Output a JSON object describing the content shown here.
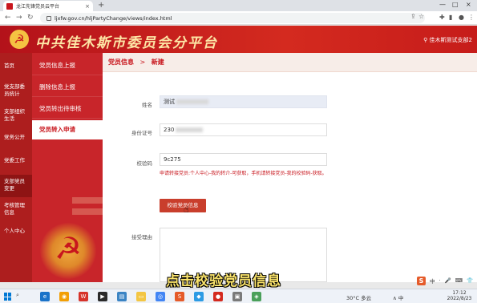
{
  "browser": {
    "tab_title": "龙江先锋党员云平台",
    "tab_close": "×",
    "new_tab": "+",
    "window_controls": [
      "—",
      "□",
      "×"
    ],
    "nav_icons": {
      "back": "←",
      "forward": "→",
      "reload": "↻"
    },
    "url": "ljxfw.gov.cn/hljPartyChange/views/index.html",
    "omni_icons": [
      "share-icon",
      "star-icon"
    ],
    "toolbar_icons": [
      "puzzle-icon",
      "sidebar-icon",
      "profile-icon",
      "more-icon"
    ]
  },
  "header": {
    "title": "中共佳木斯市委员会分平台",
    "emblem_glyph": "☭",
    "user": "佳木斯测试支部2",
    "user_icon": "user-icon"
  },
  "leftnav": [
    {
      "label": "首页",
      "active": false
    },
    {
      "label": "党支部委员统计",
      "active": false
    },
    {
      "label": "支部组织生活",
      "active": false
    },
    {
      "label": "党务公开",
      "active": false
    },
    {
      "label": "党委工作",
      "active": false
    },
    {
      "label": "支部党员变更",
      "active": true
    },
    {
      "label": "考核管理信息",
      "active": false
    },
    {
      "label": "个人中心",
      "active": false
    }
  ],
  "subnav": [
    {
      "label": "党员信息上报",
      "active": false
    },
    {
      "label": "删除信息上报",
      "active": false
    },
    {
      "label": "党员转出待审核",
      "active": false
    },
    {
      "label": "党员转入申请",
      "active": true
    }
  ],
  "breadcrumb": {
    "section": "党员信息",
    "separator": ">",
    "page": "新建"
  },
  "form": {
    "name_label": "姓名",
    "name_value": "测试",
    "id_label": "身份证号",
    "id_value": "230",
    "code_label": "校验码",
    "code_value": "9c275",
    "hint": "申请转接党员:个人中心-我的转介-可获取，手机请转接党员-我的校验码-获取。",
    "verify_button": "校验党员信息",
    "reason_label": "接受理由"
  },
  "subtitle": "点击校验党员信息",
  "ime": {
    "logo": "S",
    "items": [
      "中",
      "·",
      "🎤",
      "⌨",
      "👕",
      "⚙"
    ]
  },
  "taskbar": {
    "apps": [
      {
        "name": "edge",
        "color": "#1a73c9",
        "glyph": "e"
      },
      {
        "name": "chrome-orange",
        "color": "#f29f05",
        "glyph": "◉"
      },
      {
        "name": "wps",
        "color": "#d6332a",
        "glyph": "W"
      },
      {
        "name": "media",
        "color": "#2a2a2a",
        "glyph": "▶"
      },
      {
        "name": "files",
        "color": "#3b84c4",
        "glyph": "▤"
      },
      {
        "name": "explorer",
        "color": "#f3c644",
        "glyph": "▭"
      },
      {
        "name": "chrome",
        "color": "#4285f4",
        "glyph": "◎"
      },
      {
        "name": "sogou",
        "color": "#e55b2a",
        "glyph": "S"
      },
      {
        "name": "app9",
        "color": "#2c9be4",
        "glyph": "◆"
      },
      {
        "name": "app10",
        "color": "#d42a1f",
        "glyph": "●"
      },
      {
        "name": "app11",
        "color": "#7a7a7a",
        "glyph": "▣"
      },
      {
        "name": "app12",
        "color": "#4aa05a",
        "glyph": "◈"
      }
    ],
    "weather": "30°C 多云",
    "tray": "∧  中",
    "time": "17:12",
    "date": "2022/8/23"
  }
}
